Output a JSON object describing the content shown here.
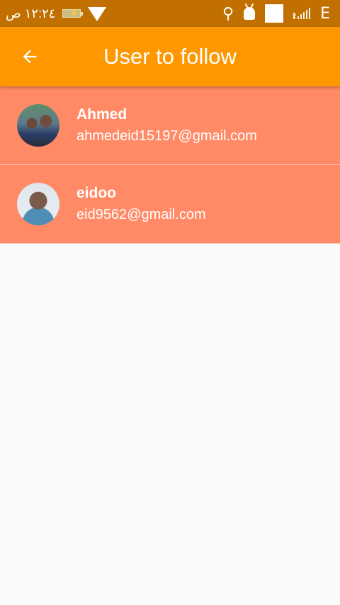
{
  "status_bar": {
    "time": "١٢:٢٤ ص",
    "network_type": "E",
    "signal_label": "2",
    "icons": [
      "battery-charging-icon",
      "wifi-icon",
      "usb-icon",
      "android-debug-icon",
      "notification-square-icon",
      "signal-icon"
    ]
  },
  "app_bar": {
    "title": "User to follow",
    "back_icon": "arrow-left-icon"
  },
  "users": [
    {
      "name": "Ahmed",
      "email": "ahmedeid15197@gmail.com"
    },
    {
      "name": "eidoo",
      "email": "eid9562@gmail.com"
    }
  ],
  "colors": {
    "status_bar": "#c17000",
    "app_bar": "#ff9800",
    "list_item": "#ff8a65",
    "background": "#fafafa"
  }
}
